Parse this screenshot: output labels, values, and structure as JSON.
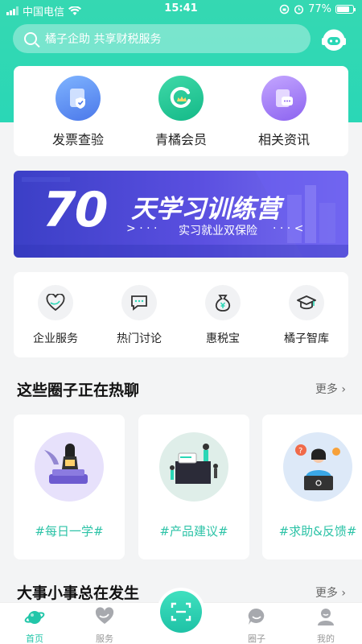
{
  "status_bar": {
    "carrier": "中国电信",
    "time": "15:41",
    "battery": "77%"
  },
  "search": {
    "placeholder": "橘子企助 共享财税服务"
  },
  "quick_actions": [
    {
      "label": "发票查验",
      "icon": "invoice-shield-icon"
    },
    {
      "label": "青橘会员",
      "icon": "orange-crown-icon"
    },
    {
      "label": "相关资讯",
      "icon": "message-doc-icon"
    }
  ],
  "banner": {
    "number": "70",
    "title": "天学习训练营",
    "subtitle": "实习就业双保险",
    "dots": "· · ·"
  },
  "services": [
    {
      "label": "企业服务",
      "icon": "heart-icon"
    },
    {
      "label": "热门讨论",
      "icon": "chat-icon"
    },
    {
      "label": "惠税宝",
      "icon": "money-bag-icon"
    },
    {
      "label": "橘子智库",
      "icon": "graduation-cap-icon"
    }
  ],
  "section1": {
    "title": "这些圈子正在热聊",
    "more": "更多"
  },
  "topics": [
    {
      "label": "#每日一学#"
    },
    {
      "label": "#产品建议#"
    },
    {
      "label": "#求助&反馈#"
    }
  ],
  "section2": {
    "title": "大事小事总在发生",
    "more": "更多"
  },
  "tabs": [
    {
      "label": "首页",
      "active": true
    },
    {
      "label": "服务"
    },
    {
      "label": "圈子"
    },
    {
      "label": "我的"
    }
  ],
  "colors": {
    "accent": "#2ad7b6",
    "active_tab": "#22c6a9",
    "topic_text": "#2dc3a7"
  }
}
